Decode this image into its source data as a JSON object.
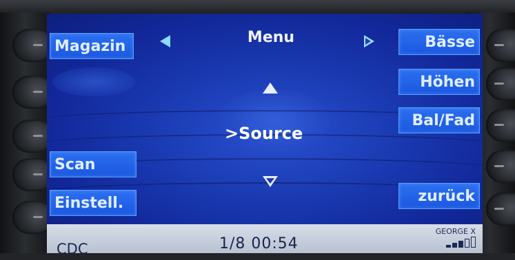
{
  "header": {
    "title": "Menu"
  },
  "left_softkeys": {
    "magazin": "Magazin",
    "scan": "Scan",
    "einstell": "Einstell."
  },
  "right_softkeys": {
    "baesse": "Bässe",
    "hoehen": "Höhen",
    "balfad": "Bal/Fad",
    "zurueck": "zurück"
  },
  "center": {
    "source_label": ">Source"
  },
  "status": {
    "source": "CDC",
    "track_time": "1/8  00:54",
    "name": "GEORGE X",
    "signal_level": 3,
    "signal_max": 5
  },
  "icons": [
    "arrow-left-icon",
    "arrow-right-icon",
    "arrow-up-icon",
    "arrow-down-icon",
    "signal-strength-icon"
  ],
  "colors": {
    "screen": "#1b3cb4",
    "softkey": "#2c6ff0",
    "status_bar": "#c9d0dd"
  }
}
